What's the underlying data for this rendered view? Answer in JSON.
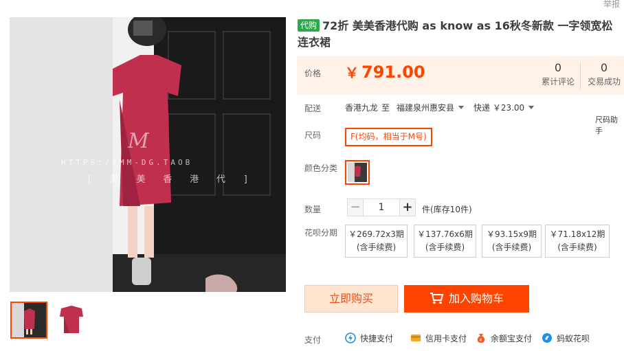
{
  "report_link": "举报",
  "title": {
    "tag": "代购",
    "text": "72折 美美香港代购 as know as 16秋冬新款 一字领宽松连衣裙"
  },
  "price": {
    "label": "价格",
    "currency": "￥",
    "amount": "791.00",
    "reviews_count": "0",
    "reviews_label": "累计评论",
    "sales_count": "0",
    "sales_label": "交易成功"
  },
  "shipping": {
    "label": "配送",
    "from": "香港九龙",
    "to_word": "至",
    "destination": "福建泉州惠安县",
    "method": "快递 ￥23.00"
  },
  "size": {
    "label": "尺码",
    "helper": "尺码助手",
    "option": "F(均码，相当于M号)"
  },
  "color": {
    "label": "颜色分类"
  },
  "quantity": {
    "label": "数量",
    "minus": "−",
    "value": "1",
    "plus": "+",
    "stock": "件(库存10件)"
  },
  "installments": {
    "label": "花呗分期",
    "options": [
      {
        "price": "￥269.72x3期",
        "fee": "(含手续费)"
      },
      {
        "price": "￥137.76x6期",
        "fee": "(含手续费)"
      },
      {
        "price": "￥93.15x9期",
        "fee": "(含手续费)"
      },
      {
        "price": "￥71.18x12期",
        "fee": "(含手续费)"
      }
    ]
  },
  "actions": {
    "buy_now": "立即购买",
    "add_to_cart": "加入购物车"
  },
  "payment": {
    "label": "支付",
    "methods": [
      "快捷支付",
      "信用卡支付",
      "余额宝支付",
      "蚂蚁花呗"
    ]
  },
  "watermark": {
    "line1": "HTTPS://MM-DG.TAOB",
    "line2": "[ 美 美 香 港 代 ]"
  },
  "colors": {
    "accent": "#ff4400",
    "price_bg": "#fff2e8",
    "tag_green": "#2ea84d",
    "dress": "#c0304e"
  }
}
